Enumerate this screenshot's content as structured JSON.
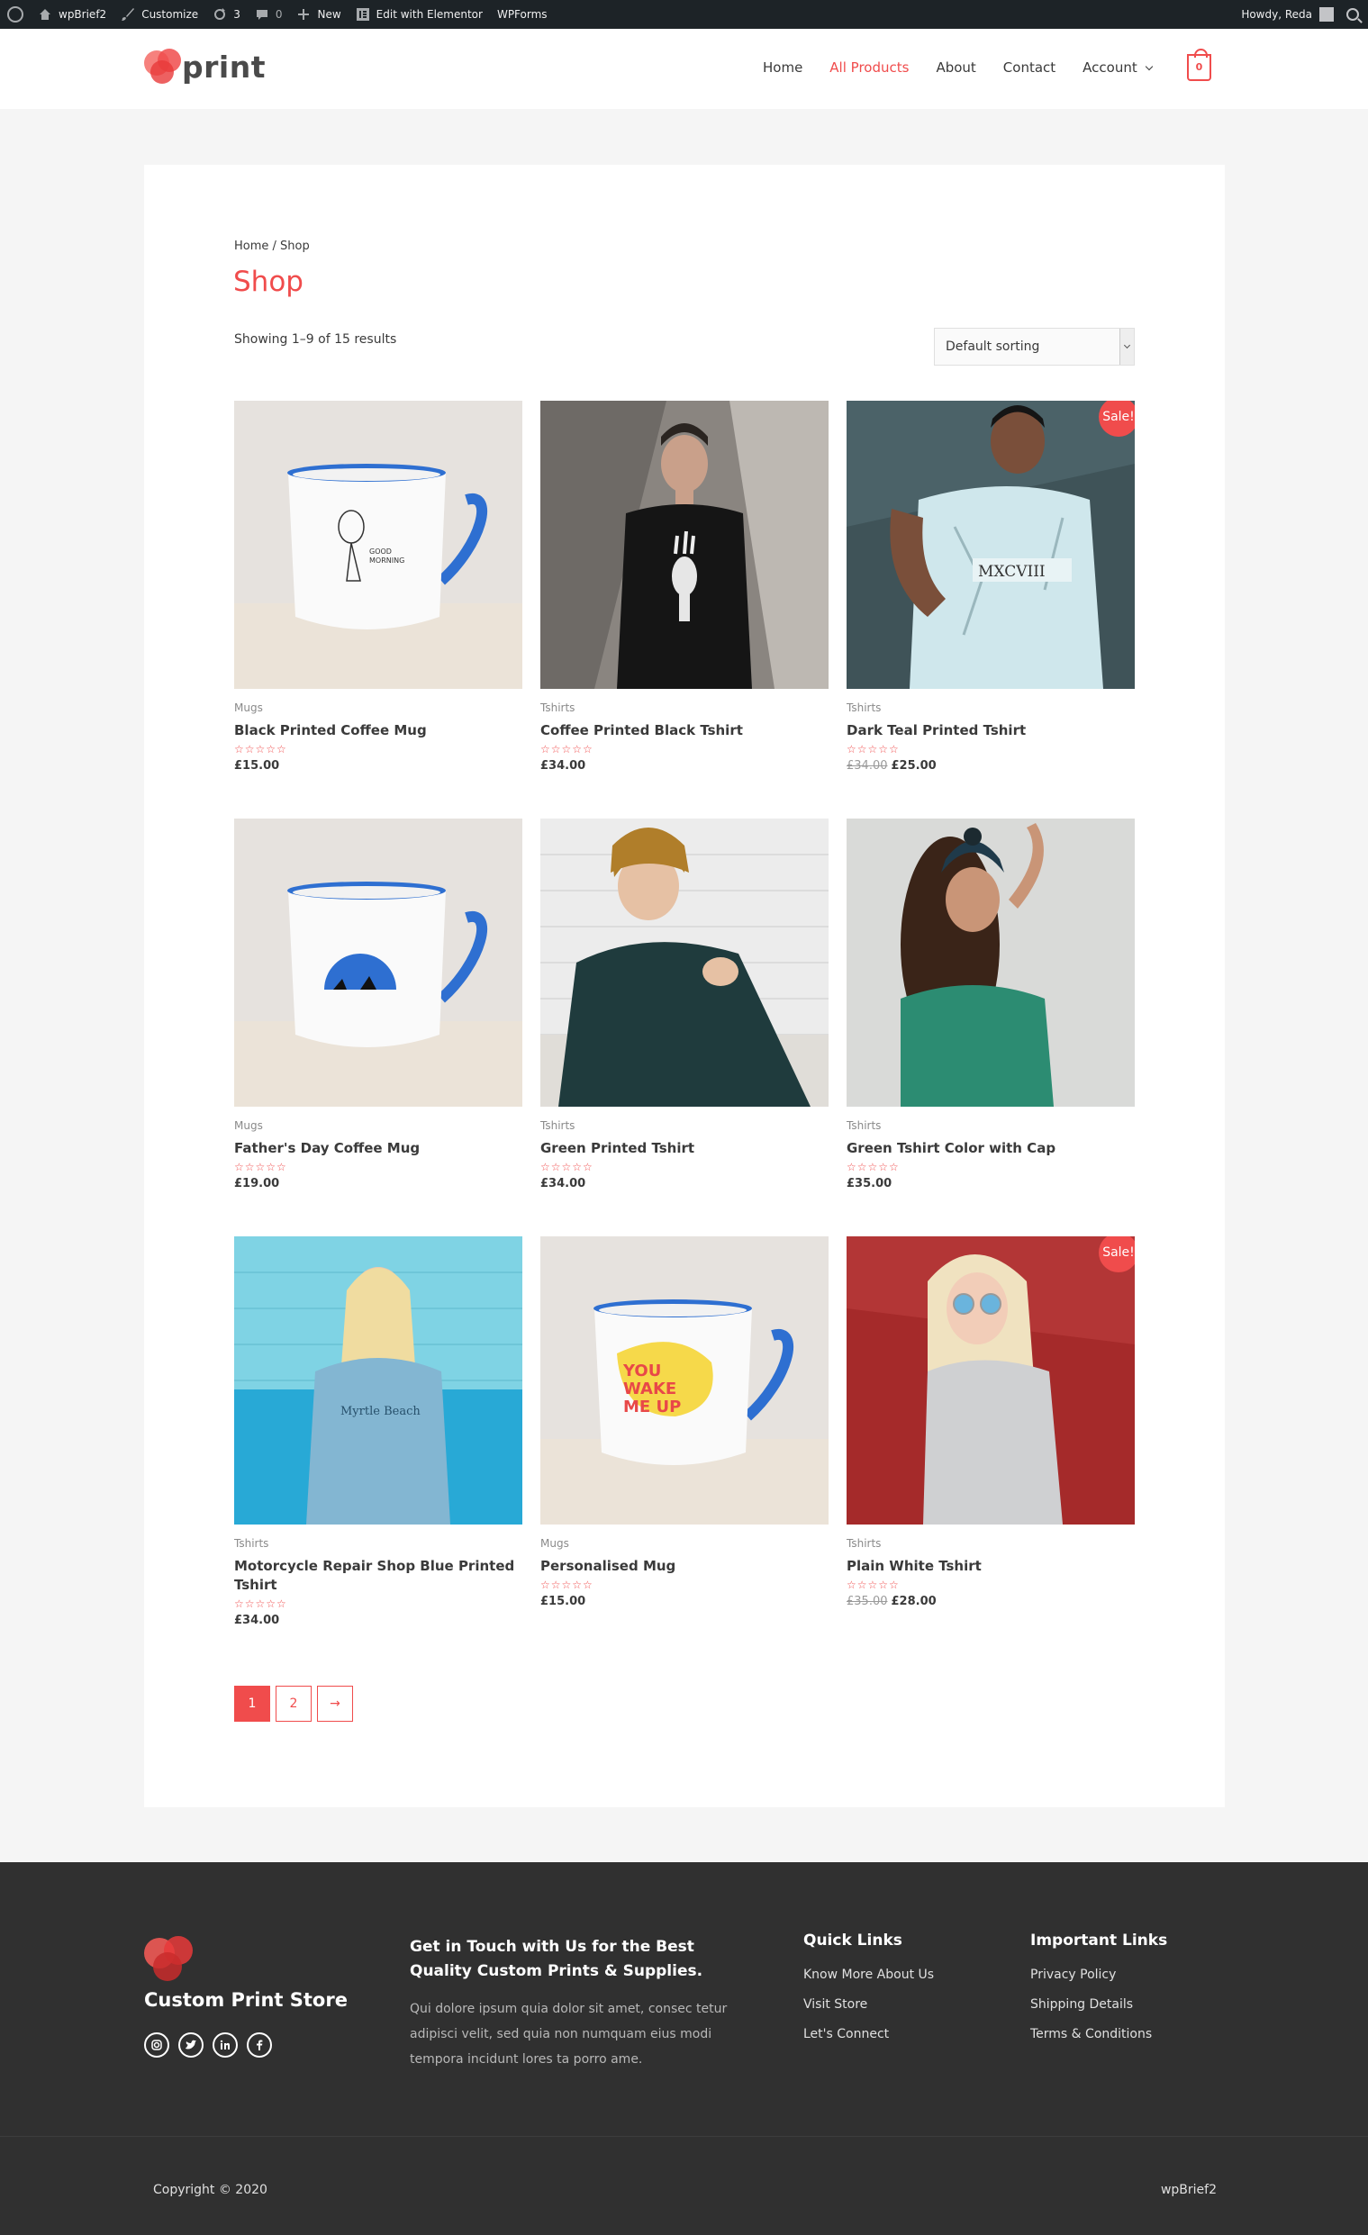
{
  "admin_bar": {
    "site_name": "wpBrief2",
    "customize": "Customize",
    "updates_count": "3",
    "comments_count": "0",
    "new_label": "New",
    "elementor_label": "Edit with Elementor",
    "wpforms_label": "WPForms",
    "howdy": "Howdy, Reda"
  },
  "header": {
    "logo_text": "print",
    "nav": [
      "Home",
      "All Products",
      "About",
      "Contact",
      "Account"
    ],
    "cart_count": "0"
  },
  "shop": {
    "breadcrumb": "Home / Shop",
    "title": "Shop",
    "result_count": "Showing 1–9 of 15 results",
    "sorting": "Default sorting",
    "stars": "☆☆☆☆☆",
    "products": [
      {
        "category": "Mugs",
        "name": "Black Printed Coffee Mug",
        "old_price": "",
        "price": "£15.00",
        "sale": ""
      },
      {
        "category": "Tshirts",
        "name": "Coffee Printed Black Tshirt",
        "old_price": "",
        "price": "£34.00",
        "sale": ""
      },
      {
        "category": "Tshirts",
        "name": "Dark Teal Printed Tshirt",
        "old_price": "£34.00",
        "price": "£25.00",
        "sale": "Sale!"
      },
      {
        "category": "Mugs",
        "name": "Father's Day Coffee Mug",
        "old_price": "",
        "price": "£19.00",
        "sale": ""
      },
      {
        "category": "Tshirts",
        "name": "Green Printed Tshirt",
        "old_price": "",
        "price": "£34.00",
        "sale": ""
      },
      {
        "category": "Tshirts",
        "name": "Green Tshirt Color with Cap",
        "old_price": "",
        "price": "£35.00",
        "sale": ""
      },
      {
        "category": "Tshirts",
        "name": "Motorcycle Repair Shop Blue Printed Tshirt",
        "old_price": "",
        "price": "£34.00",
        "sale": ""
      },
      {
        "category": "Mugs",
        "name": "Personalised Mug",
        "old_price": "",
        "price": "£15.00",
        "sale": ""
      },
      {
        "category": "Tshirts",
        "name": "Plain White Tshirt",
        "old_price": "£35.00",
        "price": "£28.00",
        "sale": "Sale!"
      }
    ],
    "pagination": {
      "page1": "1",
      "page2": "2",
      "next": "→"
    }
  },
  "footer": {
    "brand": "Custom Print Store",
    "social_icons": [
      "instagram-icon",
      "twitter-icon",
      "linkedin-icon",
      "facebook-icon"
    ],
    "cta_heading": "Get in Touch with Us for the Best Quality Custom Prints & Supplies.",
    "cta_text": "Qui dolore ipsum quia dolor sit amet, consec tetur adipisci velit, sed quia non numquam eius modi tempora incidunt lores ta porro ame.",
    "quick_links_title": "Quick Links",
    "quick_links": [
      "Know More About Us",
      "Visit Store",
      "Let's Connect"
    ],
    "important_links_title": "Important Links",
    "important_links": [
      "Privacy Policy",
      "Shipping Details",
      "Terms & Conditions"
    ],
    "copyright": "Copyright © 2020",
    "site_name": "wpBrief2"
  },
  "colors": {
    "accent": "#f04c4c",
    "admin_bar": "#1d2327",
    "footer": "#303030",
    "page_bg": "#f5f5f5"
  }
}
